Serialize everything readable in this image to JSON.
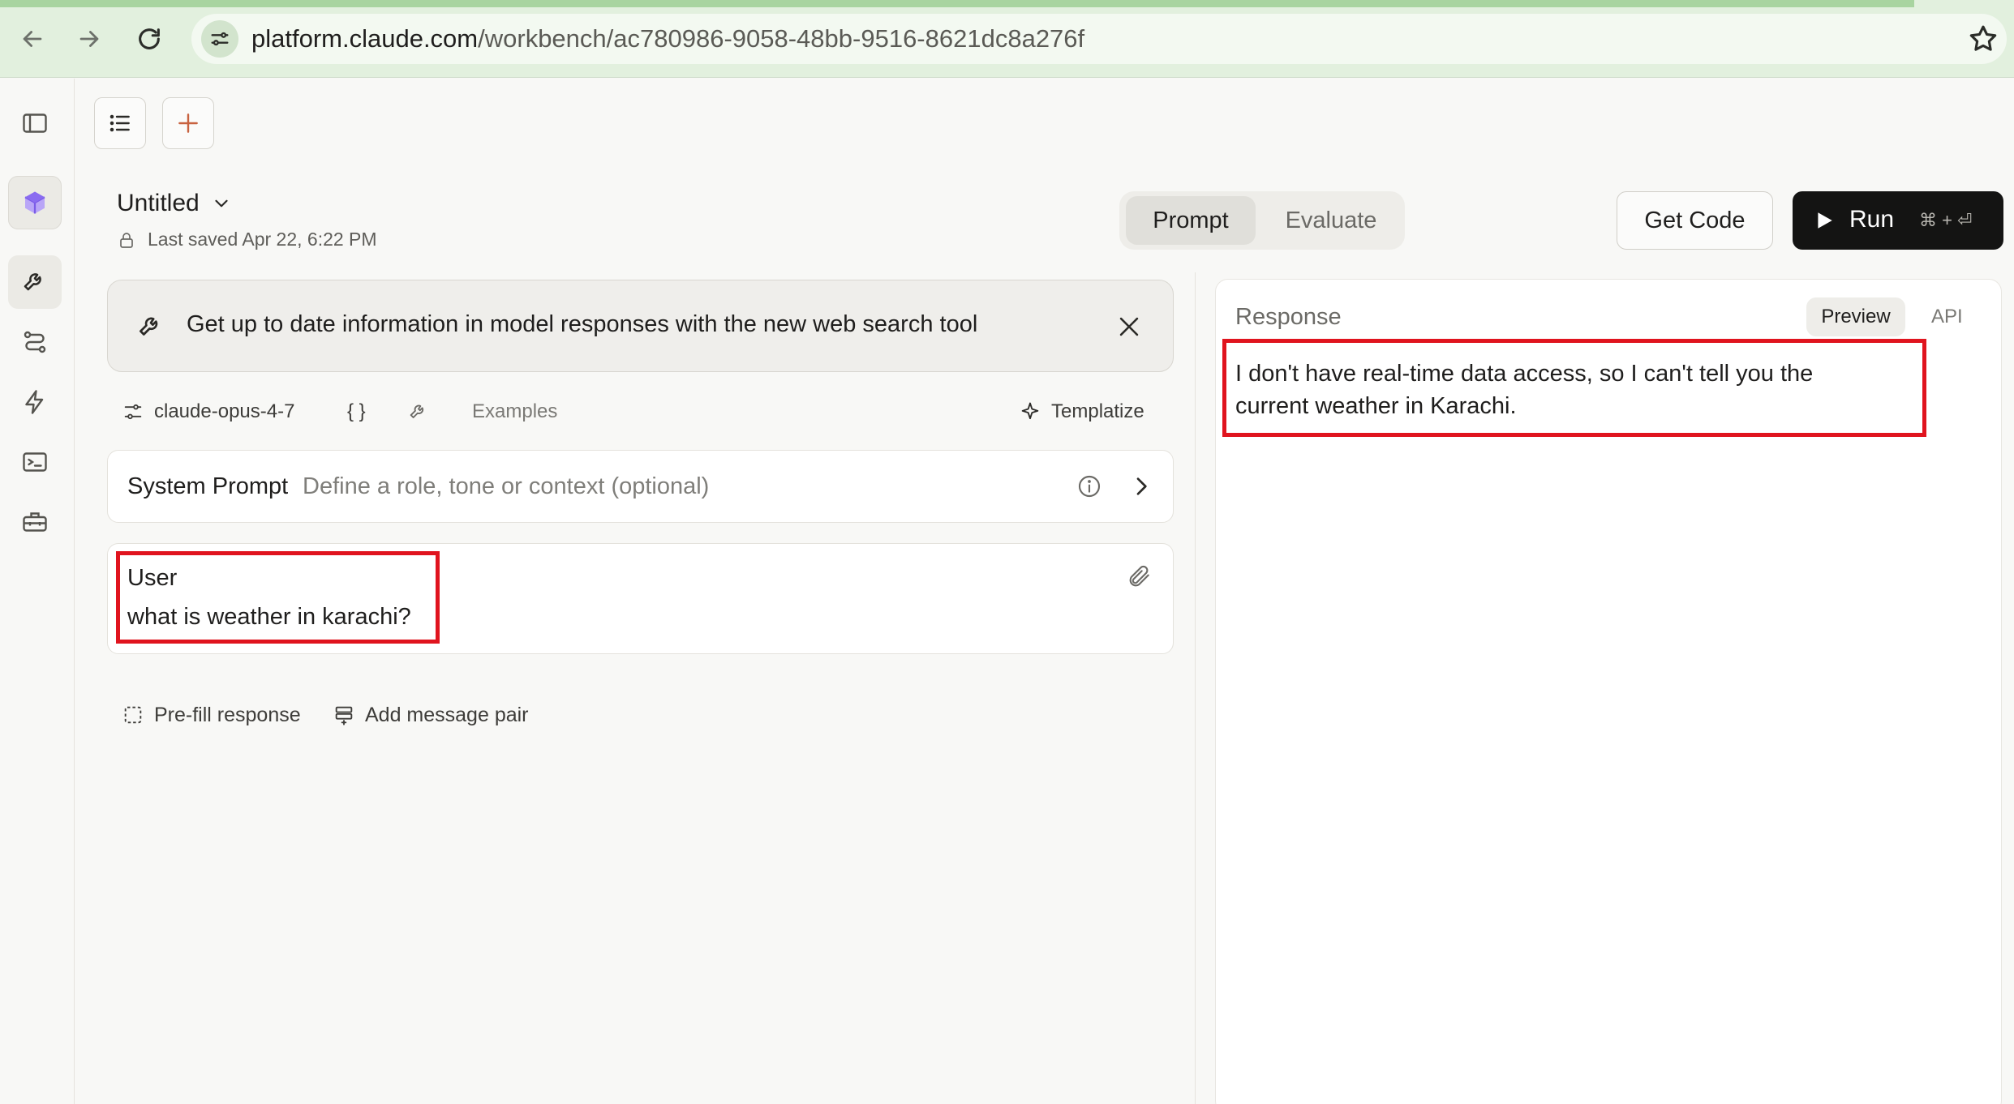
{
  "browser": {
    "url_host": "platform.claude.com",
    "url_path": "/workbench/ac780986-9058-48bb-9516-8621dc8a276f"
  },
  "header": {
    "title": "Untitled",
    "saved": "Last saved Apr 22, 6:22 PM",
    "tabs": [
      {
        "label": "Prompt",
        "active": true
      },
      {
        "label": "Evaluate",
        "active": false
      }
    ],
    "get_code": "Get Code",
    "run": "Run",
    "run_shortcut": "⌘ + ⏎"
  },
  "banner": {
    "message": "Get up to date information in model responses with the new web search tool"
  },
  "toolbar": {
    "model": "claude-opus-4-7",
    "variables": "{ }",
    "examples": "Examples",
    "templatize": "Templatize"
  },
  "system_prompt": {
    "label": "System Prompt",
    "placeholder": "Define a role, tone or context (optional)"
  },
  "messages": [
    {
      "role": "User",
      "content": "what is weather in karachi?"
    }
  ],
  "actions": {
    "prefill": "Pre-fill response",
    "add_pair": "Add message pair"
  },
  "response": {
    "heading": "Response",
    "preview": "Preview",
    "api": "API",
    "text": "I don't have real-time data access, so I can't tell you the current weather in Karachi."
  },
  "colors": {
    "highlight": "#e0141e",
    "run_bg": "#141413",
    "chrome_bg": "#e2f0de",
    "accent_cube": "#8a6cf0"
  }
}
